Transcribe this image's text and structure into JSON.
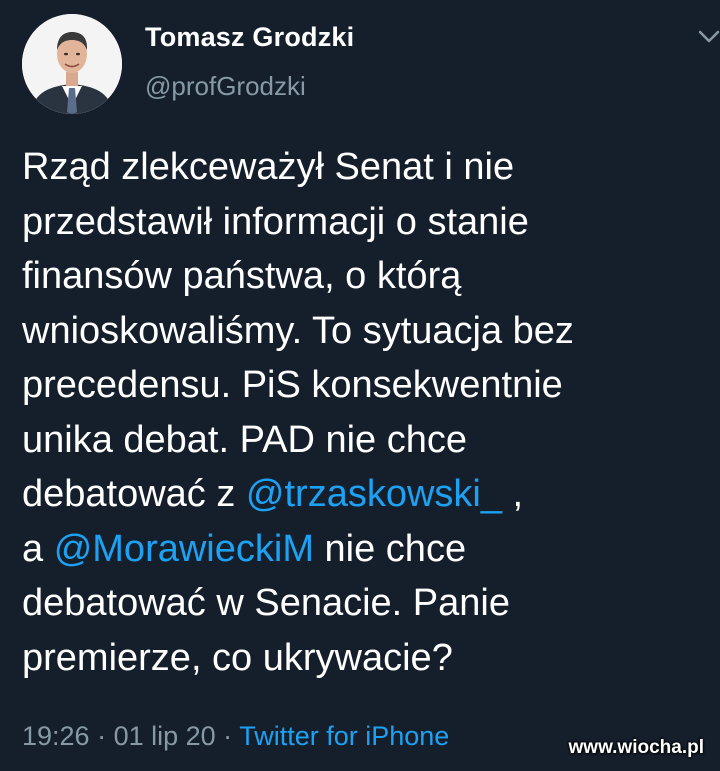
{
  "author": {
    "name": "Tomasz Grodzki",
    "handle": "@profGrodzki"
  },
  "icons": {
    "menu": "chevron-down-icon",
    "avatar": "profile-photo"
  },
  "colors": {
    "background": "#151f2c",
    "text": "#ffffff",
    "secondary": "#8899a6",
    "link": "#1da1f2"
  },
  "tweet": {
    "lines": [
      "Rząd zlekceważył Senat i nie",
      "przedstawił informacji o stanie",
      "finansów państwa, o którą",
      "wnioskowaliśmy. To sytuacja bez",
      "precedensu. PiS konsekwentnie",
      "unika debat. PAD nie chce"
    ],
    "line7_before": "debatować z ",
    "mention1": "@trzaskowski_",
    "line7_after": " ,",
    "line8_before": "a ",
    "mention2": "@MorawieckiM",
    "line8_after": " nie chce",
    "line9": "debatować w Senacie. Panie",
    "line10": "premierze, co ukrywacie?"
  },
  "meta": {
    "time": "19:26",
    "separator1": " · ",
    "date": "01 lip 20",
    "separator2": " · ",
    "source": "Twitter for iPhone"
  },
  "watermark": "www.wiocha.pl"
}
